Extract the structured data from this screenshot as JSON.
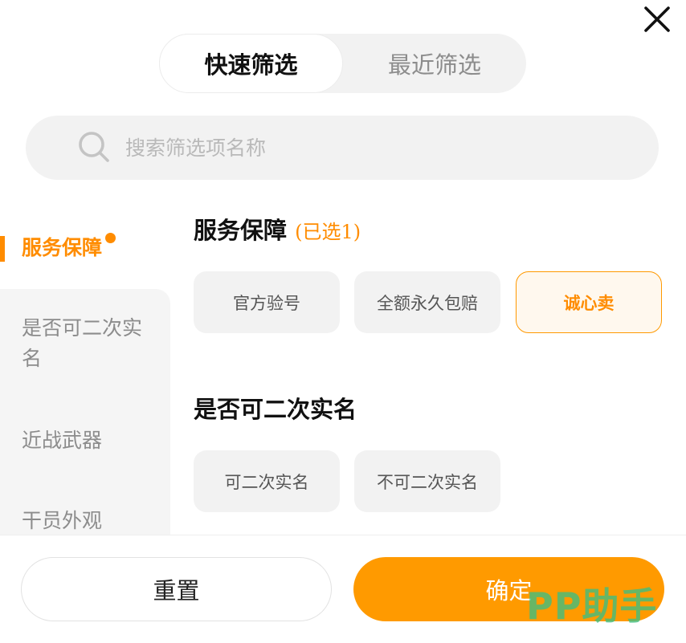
{
  "tabs": [
    {
      "label": "快速筛选",
      "active": true
    },
    {
      "label": "最近筛选",
      "active": false
    }
  ],
  "search": {
    "placeholder": "搜索筛选项名称"
  },
  "sidebar": {
    "items": [
      {
        "label": "服务保障",
        "active": true
      },
      {
        "label": "是否可二次实名"
      },
      {
        "label": "近战武器"
      },
      {
        "label": "干员外观"
      }
    ]
  },
  "sections": [
    {
      "title": "服务保障",
      "selected_text": "(已选1)",
      "options": [
        {
          "label": "官方验号",
          "selected": false
        },
        {
          "label": "全额永久包赔",
          "selected": false
        },
        {
          "label": "诚心卖",
          "selected": true
        }
      ]
    },
    {
      "title": "是否可二次实名",
      "options": [
        {
          "label": "可二次实名",
          "selected": false
        },
        {
          "label": "不可二次实名",
          "selected": false
        }
      ]
    }
  ],
  "footer": {
    "reset_label": "重置",
    "confirm_label": "确定"
  },
  "watermark": "PP助手",
  "colors": {
    "accent": "#ff9a00",
    "accent_text": "#ff8c00",
    "chip_bg": "#f2f2f2",
    "watermark": "#3cbe82"
  },
  "icons": {
    "close": "close-icon",
    "search": "search-icon"
  }
}
